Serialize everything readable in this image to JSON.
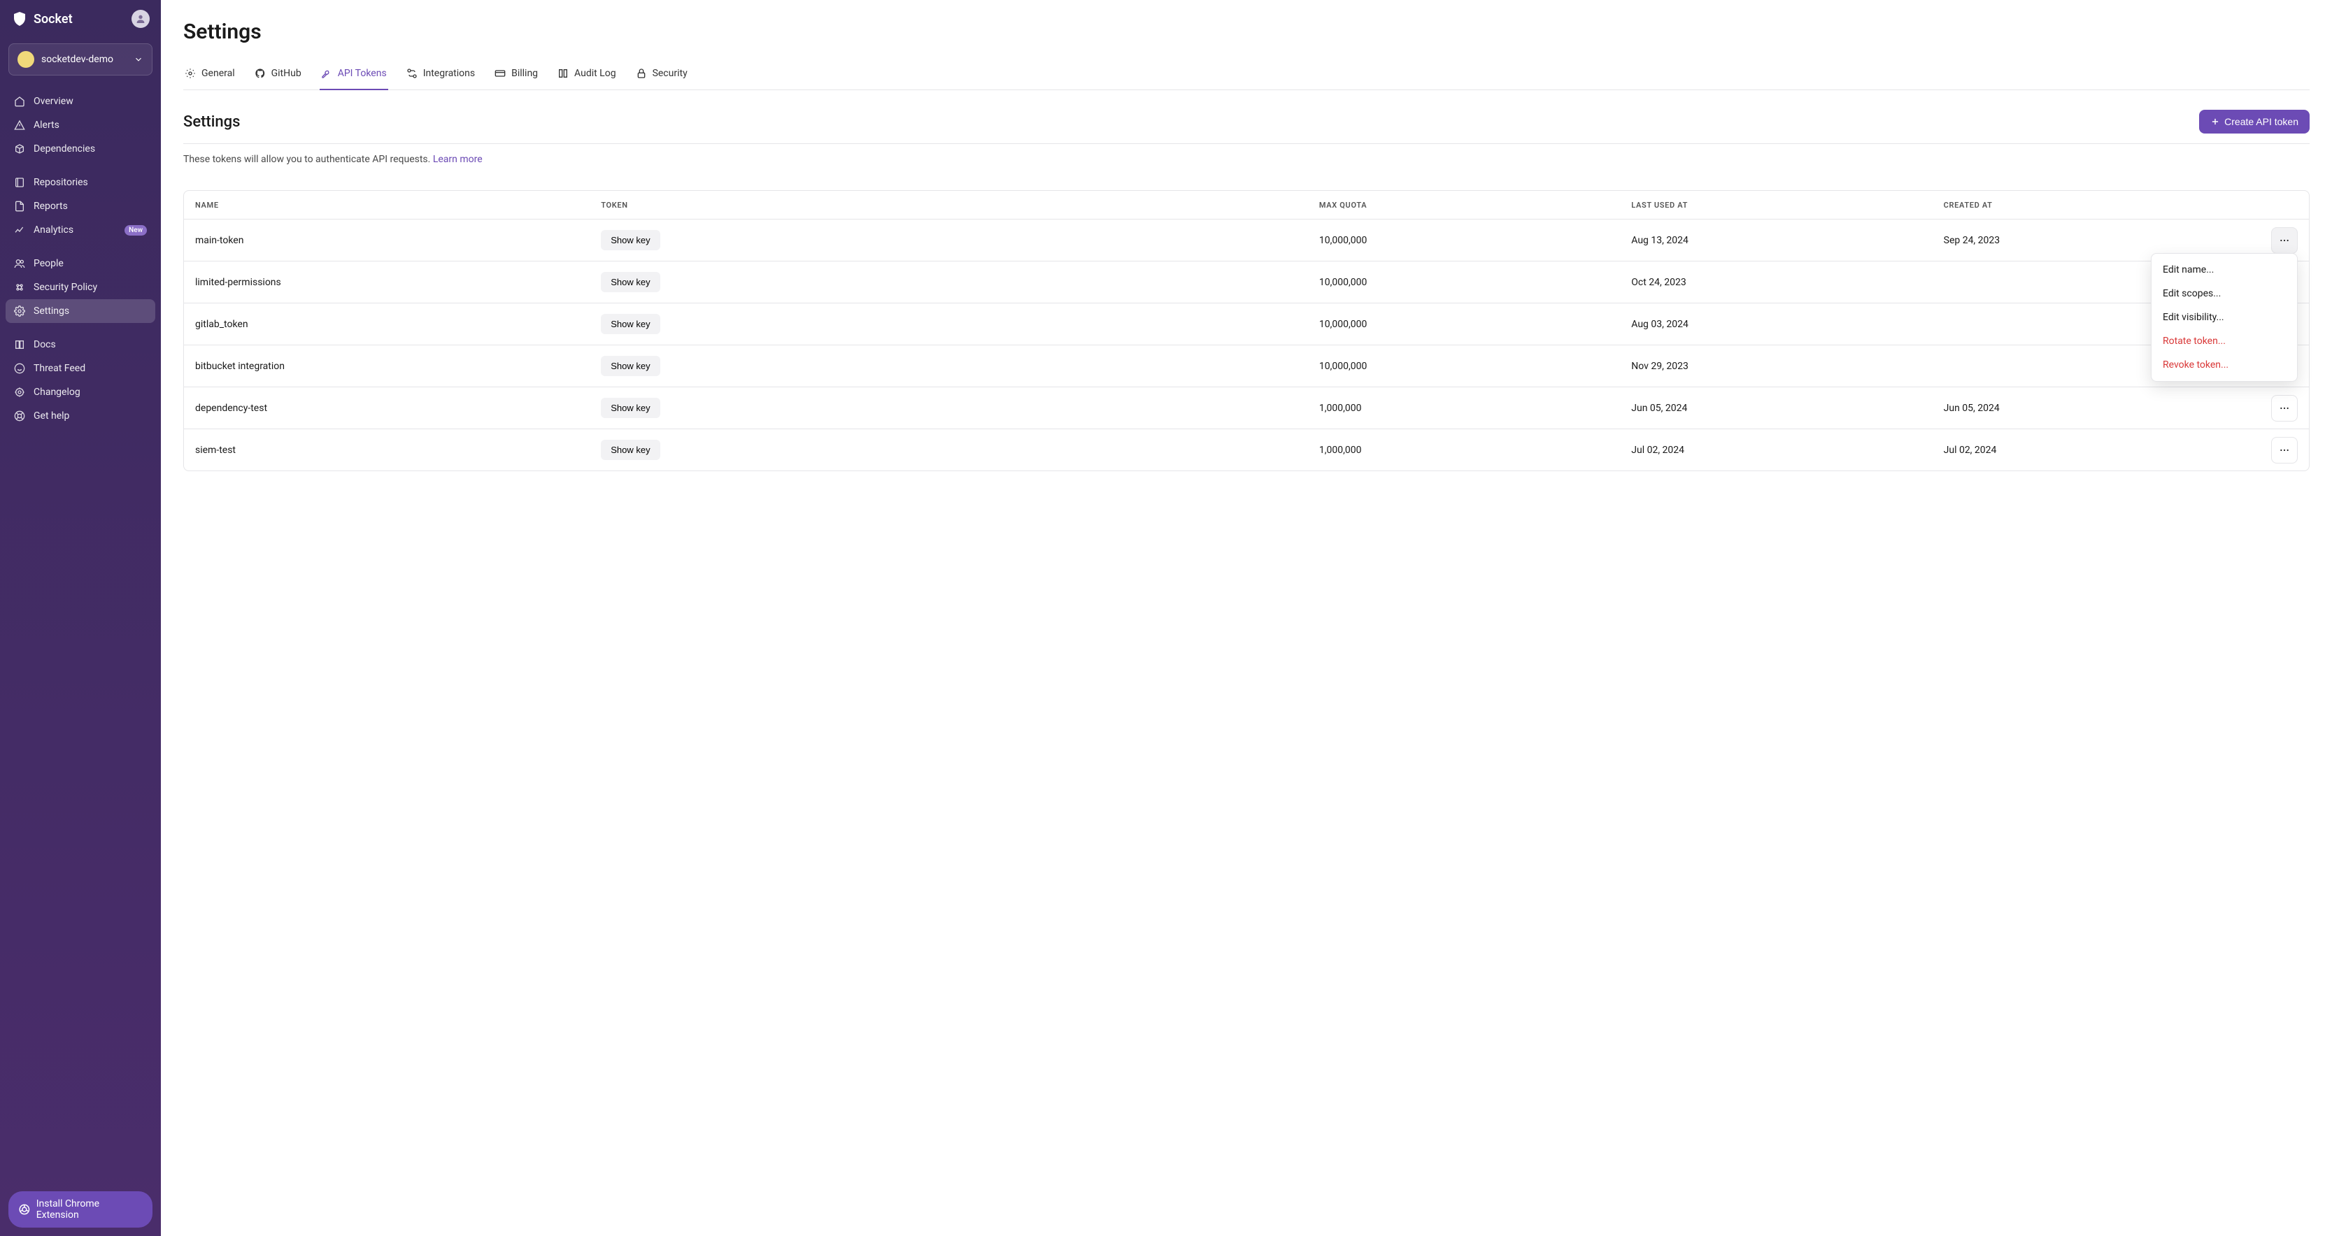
{
  "brand": "Socket",
  "org": "socketdev-demo",
  "sidebar": {
    "groups": [
      {
        "items": [
          {
            "id": "overview",
            "label": "Overview"
          },
          {
            "id": "alerts",
            "label": "Alerts"
          },
          {
            "id": "dependencies",
            "label": "Dependencies"
          }
        ]
      },
      {
        "items": [
          {
            "id": "repositories",
            "label": "Repositories"
          },
          {
            "id": "reports",
            "label": "Reports"
          },
          {
            "id": "analytics",
            "label": "Analytics",
            "badge": "New"
          }
        ]
      },
      {
        "items": [
          {
            "id": "people",
            "label": "People"
          },
          {
            "id": "security-policy",
            "label": "Security Policy"
          },
          {
            "id": "settings",
            "label": "Settings",
            "active": true
          }
        ]
      },
      {
        "items": [
          {
            "id": "docs",
            "label": "Docs"
          },
          {
            "id": "threat-feed",
            "label": "Threat Feed"
          },
          {
            "id": "changelog",
            "label": "Changelog"
          },
          {
            "id": "get-help",
            "label": "Get help"
          }
        ]
      }
    ],
    "install_ext": "Install Chrome Extension"
  },
  "page": {
    "title": "Settings",
    "tabs": [
      {
        "id": "general",
        "label": "General"
      },
      {
        "id": "github",
        "label": "GitHub"
      },
      {
        "id": "api-tokens",
        "label": "API Tokens",
        "active": true
      },
      {
        "id": "integrations",
        "label": "Integrations"
      },
      {
        "id": "billing",
        "label": "Billing"
      },
      {
        "id": "audit-log",
        "label": "Audit Log"
      },
      {
        "id": "security",
        "label": "Security"
      }
    ],
    "section_title": "Settings",
    "create_btn": "Create API token",
    "desc_text": "These tokens will allow you to authenticate API requests. ",
    "desc_link": "Learn more"
  },
  "table": {
    "columns": [
      "Name",
      "Token",
      "Max Quota",
      "Last Used At",
      "Created At"
    ],
    "show_key_label": "Show key",
    "rows": [
      {
        "name": "main-token",
        "quota": "10,000,000",
        "last_used": "Aug 13, 2024",
        "created": "Sep 24, 2023",
        "actions_open": true
      },
      {
        "name": "limited-permissions",
        "quota": "10,000,000",
        "last_used": "Oct 24, 2023",
        "created": ""
      },
      {
        "name": "gitlab_token",
        "quota": "10,000,000",
        "last_used": "Aug 03, 2024",
        "created": ""
      },
      {
        "name": "bitbucket integration",
        "quota": "10,000,000",
        "last_used": "Nov 29, 2023",
        "created": ""
      },
      {
        "name": "dependency-test",
        "quota": "1,000,000",
        "last_used": "Jun 05, 2024",
        "created": "Jun 05, 2024"
      },
      {
        "name": "siem-test",
        "quota": "1,000,000",
        "last_used": "Jul 02, 2024",
        "created": "Jul 02, 2024"
      }
    ]
  },
  "dropdown": {
    "items": [
      {
        "label": "Edit name...",
        "danger": false
      },
      {
        "label": "Edit scopes...",
        "danger": false
      },
      {
        "label": "Edit visibility...",
        "danger": false
      },
      {
        "label": "Rotate token...",
        "danger": true
      },
      {
        "label": "Revoke token...",
        "danger": true
      }
    ]
  },
  "colors": {
    "accent": "#6c4bb5",
    "danger": "#d93838",
    "sidebar_bg_top": "#3b2a5e",
    "sidebar_bg_bottom": "#4a2d6b"
  }
}
